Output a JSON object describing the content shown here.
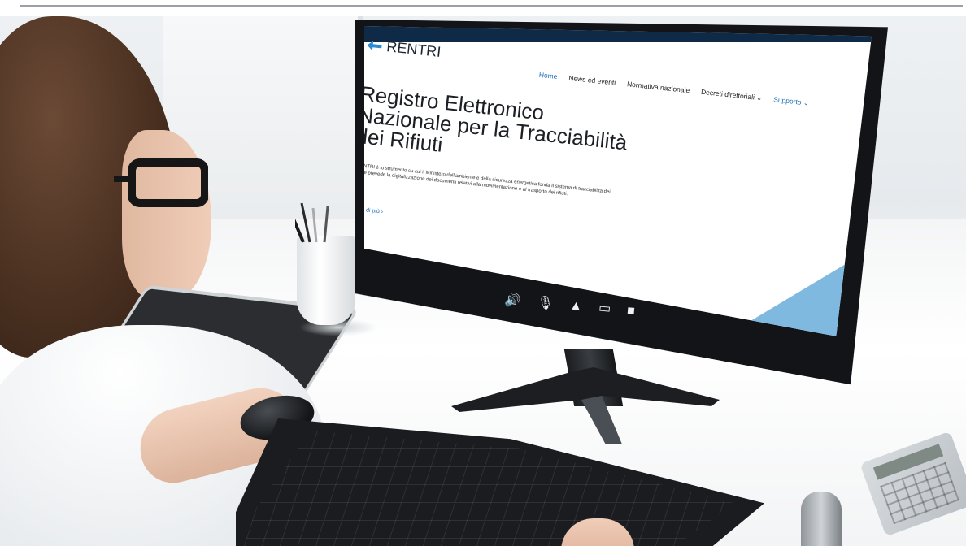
{
  "image": {
    "description": "",
    "colors": {
      "screen_header": "#0f2a47",
      "link_blue": "#1f6fb8",
      "accent_wedge": "#7fb9df"
    }
  },
  "screen": {
    "logo_text": "RENTRI",
    "nav": [
      "Home",
      "News ed eventi",
      "Normativa nazionale",
      "Decreti direttoriali ⌄",
      "Supporto ⌄"
    ],
    "hero_title_line1": "Registro Elettronico",
    "hero_title_line2": "Nazionale per la Tracciabilità",
    "hero_title_line3": "dei Rifiuti",
    "hero_text": "Il RENTRI è lo strumento su cui il Ministero dell'ambiente e della sicurezza energetica fonda il sistema di tracciabilità dei rifiuti e prevede la digitalizzazione dei documenti relativi alla movimentazione e al trasporto dei rifiuti.",
    "hero_link": "Scopri di più  ›",
    "taskbar_icons": [
      "speaker-icon",
      "microphone-icon",
      "user-icon",
      "monitor-icon",
      "video-camera-icon"
    ]
  }
}
